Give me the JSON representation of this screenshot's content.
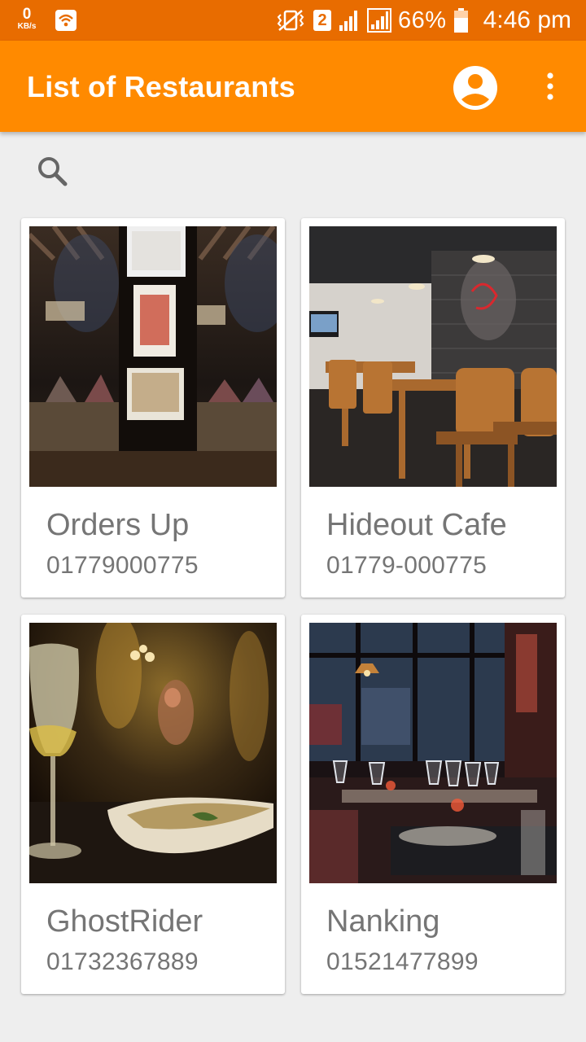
{
  "status_bar": {
    "speed_value": "0",
    "speed_unit": "KB/s",
    "sim_slot": "2",
    "battery_percent": "66%",
    "time": "4:46 pm",
    "icons": [
      "wifi-app-icon",
      "vibrate-icon",
      "sim-icon",
      "signal-icon",
      "signal-icon",
      "battery-icon"
    ]
  },
  "app_bar": {
    "title": "List of Restaurants",
    "account_icon": "account-circle-icon",
    "menu_icon": "more-vert-icon",
    "color": "#ff8a00"
  },
  "search": {
    "icon": "search-icon"
  },
  "restaurants": [
    {
      "name": "Orders Up",
      "phone": "01779000775",
      "image": "restaurant-interior-lounge"
    },
    {
      "name": "Hideout Cafe",
      "phone": "01779-000775",
      "image": "restaurant-interior-wooden-chairs"
    },
    {
      "name": "GhostRider",
      "phone": "01732367889",
      "image": "restaurant-wine-glass-dish"
    },
    {
      "name": "Nanking",
      "phone": "01521477899",
      "image": "restaurant-dining-tables-glasses"
    }
  ]
}
